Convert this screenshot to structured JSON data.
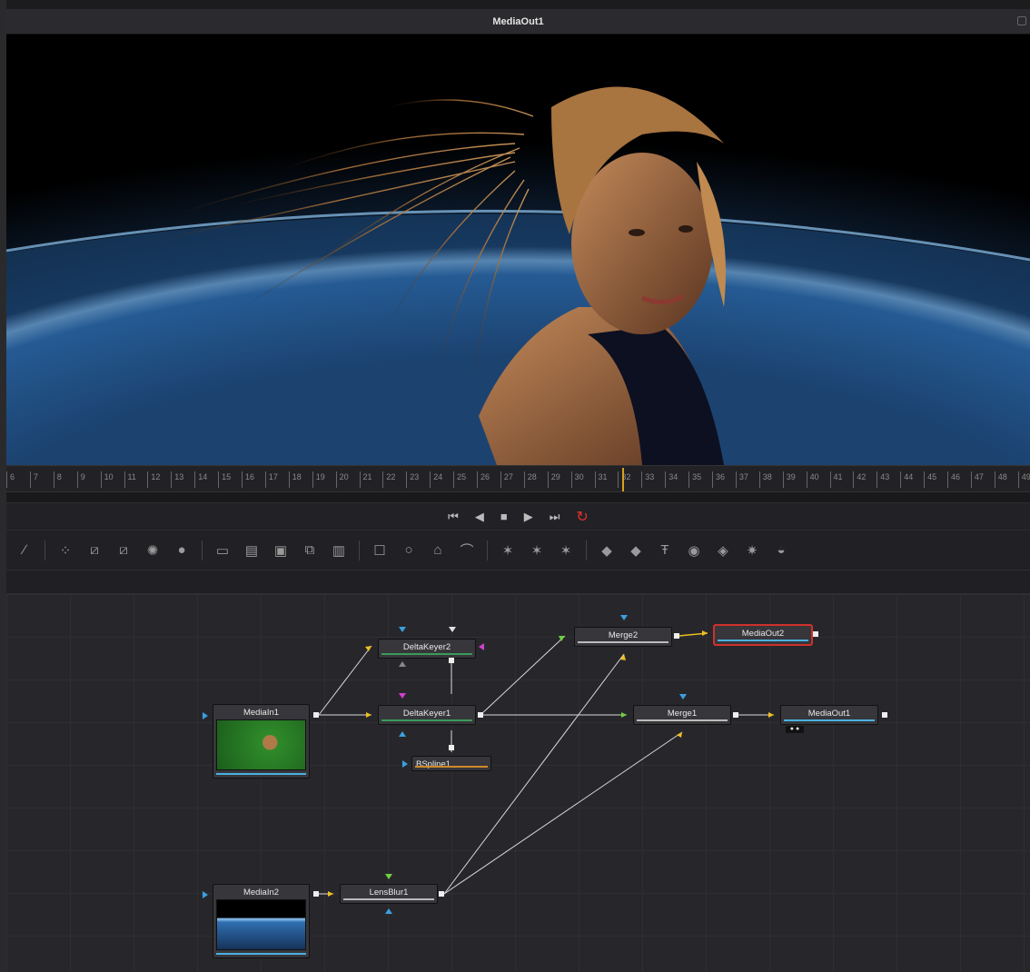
{
  "viewer": {
    "title": "MediaOut1"
  },
  "ruler": {
    "frames": [
      "6",
      "7",
      "8",
      "9",
      "10",
      "11",
      "12",
      "13",
      "14",
      "15",
      "16",
      "17",
      "18",
      "19",
      "20",
      "21",
      "22",
      "23",
      "24",
      "25",
      "26",
      "27",
      "28",
      "29",
      "30",
      "31",
      "32",
      "33",
      "34",
      "35",
      "36",
      "37",
      "38",
      "39",
      "40",
      "41",
      "42",
      "43",
      "44",
      "45",
      "46",
      "47",
      "48",
      "49"
    ],
    "current_frame": "32"
  },
  "transport": {
    "icons": [
      "go-to-start-icon",
      "step-back-icon",
      "stop-icon",
      "play-icon",
      "go-to-end-icon",
      "loop-icon"
    ]
  },
  "toolbar": {
    "icons": [
      "paint-icon",
      "background-icon",
      "fast-noise-icon",
      "text-icon",
      "color-corrector-icon",
      "blur-icon",
      "merge-icon",
      "channel-booleans-icon",
      "matte-control-icon",
      "transform-icon",
      "resize-icon",
      "rectangle-mask-icon",
      "ellipse-mask-icon",
      "polygon-mask-icon",
      "bspline-mask-icon",
      "particle-emitter-icon",
      "particle-render-icon",
      "particle-style-icon",
      "shape3d-icon",
      "merge3d-icon",
      "text3d-icon",
      "camera3d-icon",
      "renderer3d-icon",
      "light-icon",
      "image-plane-icon"
    ]
  },
  "nodes": {
    "mediain1": "MediaIn1",
    "mediain2": "MediaIn2",
    "deltakeyer1": "DeltaKeyer1",
    "deltakeyer2": "DeltaKeyer2",
    "bspline1": "BSpline1",
    "lensblur1": "LensBlur1",
    "merge1": "Merge1",
    "merge2": "Merge2",
    "mediaout1": "MediaOut1",
    "mediaout2": "MediaOut2"
  },
  "colors": {
    "playhead": "#d9a21b",
    "selected": "#d0302a",
    "wire": "#d8d8d8",
    "loop": "#e03030"
  }
}
